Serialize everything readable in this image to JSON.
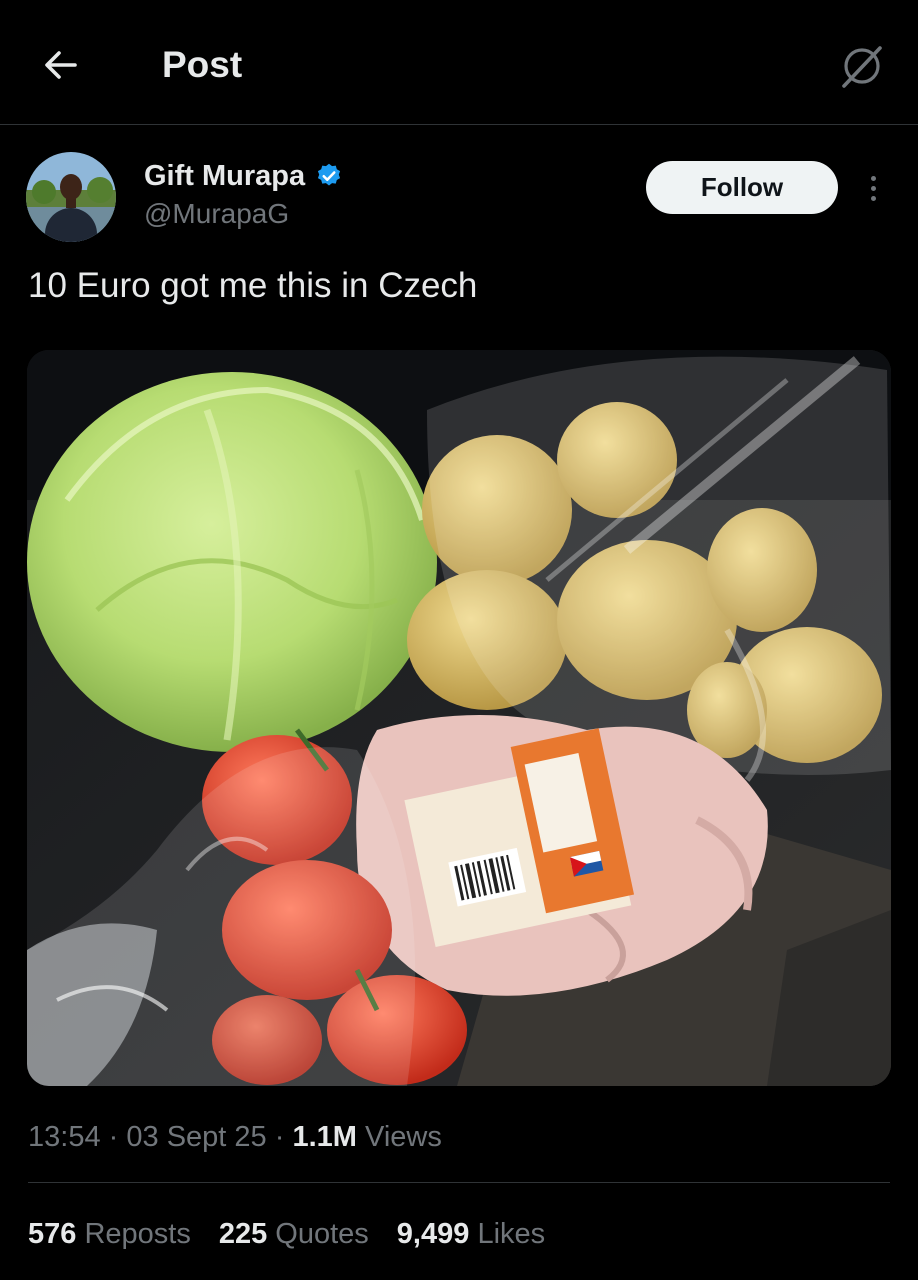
{
  "header": {
    "title": "Post",
    "back_icon": "arrow-left-icon",
    "grok_icon": "grok-slash-icon"
  },
  "author": {
    "name": "Gift Murapa",
    "handle": "@MurapaG",
    "verified_icon": "verified-badge-icon",
    "verified_color": "#1d9bf0"
  },
  "follow_label": "Follow",
  "more_icon": "more-vertical-icon",
  "post": {
    "text": "10 Euro got me this in Czech"
  },
  "meta": {
    "time": "13:54",
    "date": "03 Sept 25",
    "views_count": "1.1M",
    "views_label": "Views",
    "separator": "·"
  },
  "stats": {
    "reposts_count": "576",
    "reposts_label": "Reposts",
    "quotes_count": "225",
    "quotes_label": "Quotes",
    "likes_count": "9,499",
    "likes_label": "Likes"
  },
  "colors": {
    "background": "#000000",
    "text_primary": "#e7e9ea",
    "text_secondary": "#71767b",
    "divider": "#2f3336"
  }
}
